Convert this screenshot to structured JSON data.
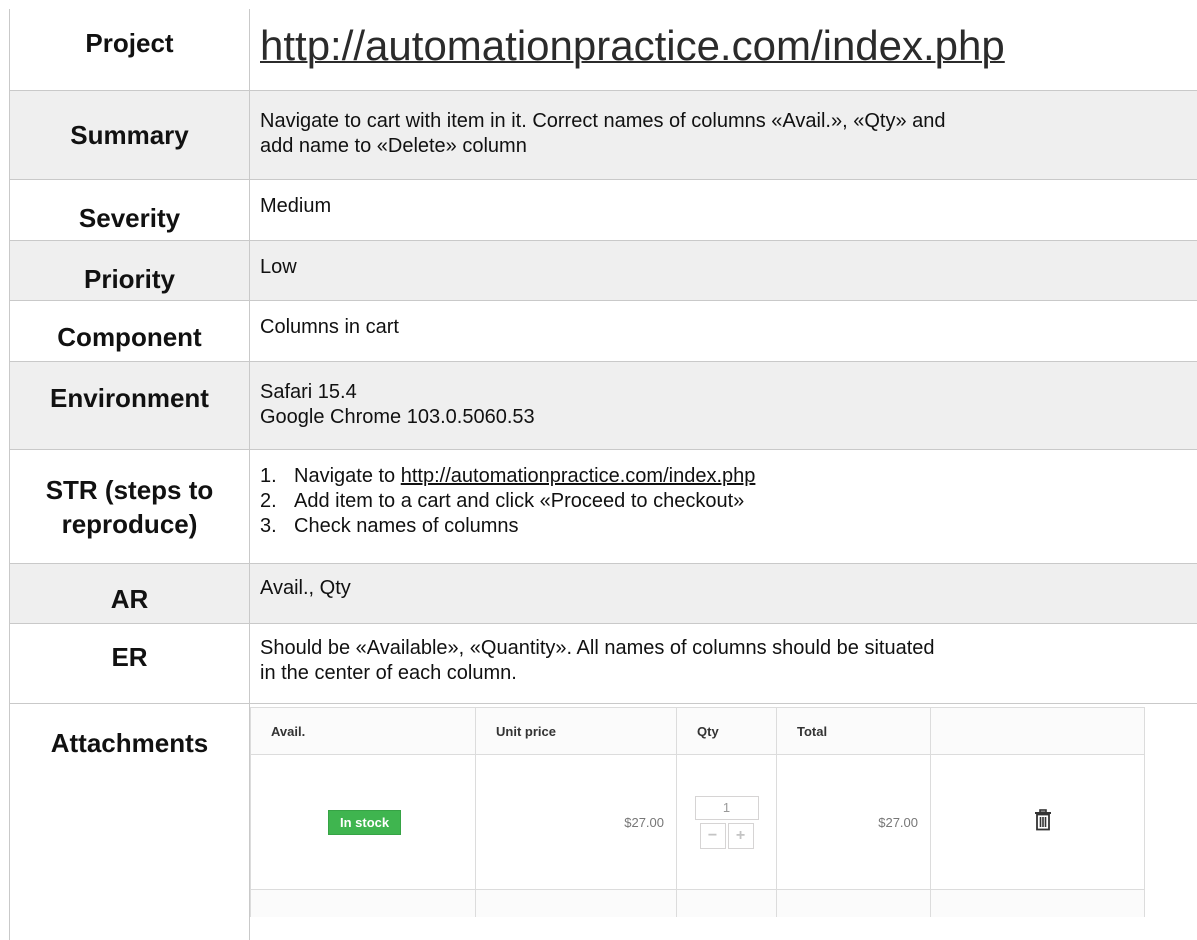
{
  "project": {
    "label": "Project",
    "value": "http://automationpractice.com/index.php"
  },
  "summary": {
    "label": "Summary",
    "lines": [
      "Navigate to cart with item in it. Correct names of columns «Avail.», «Qty» and",
      "add name to «Delete» column"
    ]
  },
  "severity": {
    "label": "Severity",
    "value": "Medium"
  },
  "priority": {
    "label": "Priority",
    "value": "Low"
  },
  "component": {
    "label": "Component",
    "value": "Columns in cart"
  },
  "environment": {
    "label": "Environment",
    "lines": [
      "Safari 15.4",
      "Google Chrome 103.0.5060.53"
    ]
  },
  "str": {
    "label_line1": "STR (steps to",
    "label_line2": "reproduce)",
    "steps": [
      {
        "num": "1.",
        "prefix": "Navigate to ",
        "link": "http://automationpractice.com/index.php"
      },
      {
        "num": "2.",
        "text": "Add item to a cart and click «Proceed to checkout»"
      },
      {
        "num": "3.",
        "text": "Check names of columns"
      }
    ]
  },
  "ar": {
    "label": "AR",
    "value": "Avail., Qty"
  },
  "er": {
    "label": "ER",
    "lines": [
      "Should be «Available», «Quantity». All names of columns should be situated",
      "in the center of each column."
    ]
  },
  "attachments": {
    "label": "Attachments",
    "cart": {
      "headers": [
        "Avail.",
        "Unit price",
        "Qty",
        "Total",
        ""
      ],
      "row": {
        "availability": "In stock",
        "unit_price": "$27.00",
        "qty": "1",
        "minus": "−",
        "plus": "+",
        "total": "$27.00",
        "delete_icon": "trash-icon"
      },
      "badge_color": "#3fb54f"
    }
  }
}
